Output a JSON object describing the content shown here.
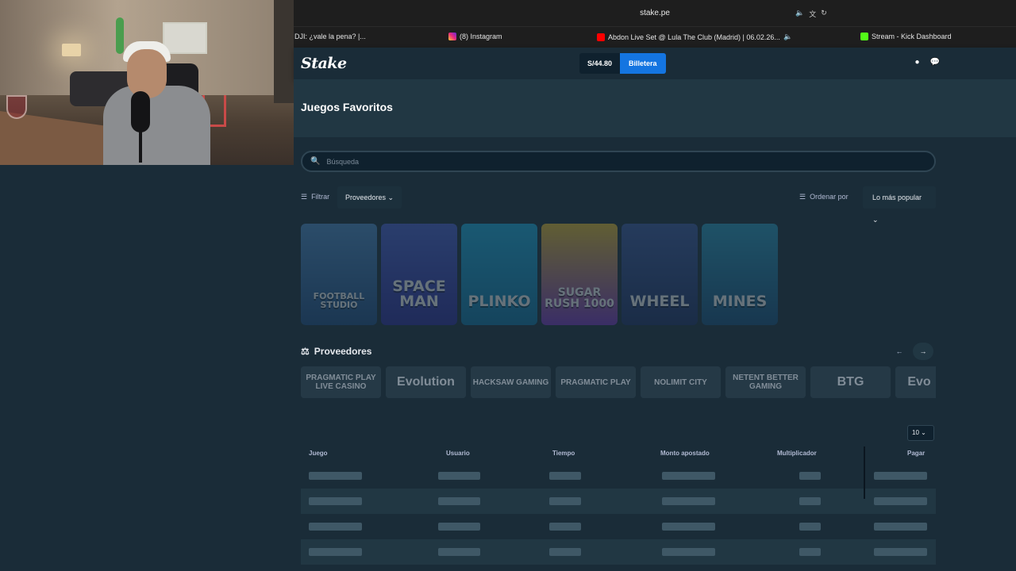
{
  "browser": {
    "url": "stake.pe",
    "tabs": [
      {
        "label": "DJI: ¿vale la pena? |...",
        "icon": "none"
      },
      {
        "label": "(8) Instagram",
        "icon": "instagram-icon"
      },
      {
        "label": "Abdon Live Set @ Lula The Club (Madrid) | 06.02.26...",
        "icon": "youtube-icon"
      },
      {
        "label": "Stream - Kick Dashboard",
        "icon": "kick-icon"
      }
    ]
  },
  "header": {
    "logo": "Stake",
    "balance": "S/44.80",
    "wallet_label": "Billetera"
  },
  "page": {
    "title": "Juegos Favoritos",
    "search_placeholder": "Búsqueda",
    "filter_label": "Filtrar",
    "providers_dropdown": "Proveedores",
    "sort_label": "Ordenar por",
    "sort_value": "Lo más popular"
  },
  "games": [
    "FOOTBALL STUDIO",
    "SPACE MAN",
    "PLINKO",
    "SUGAR RUSH 1000",
    "WHEEL",
    "MINES"
  ],
  "providers": {
    "title": "Proveedores",
    "items": [
      "PRAGMATIC PLAY LIVE CASINO",
      "Evolution",
      "HACKSAW GAMING",
      "PRAGMATIC PLAY",
      "NOLIMIT CITY",
      "NETENT BETTER GAMING",
      "BTG",
      "Evo"
    ]
  },
  "bets_table": {
    "page_size": "10",
    "columns": [
      "Juego",
      "Usuario",
      "Tiempo",
      "Monto apostado",
      "Multiplicador",
      "Pagar"
    ]
  }
}
